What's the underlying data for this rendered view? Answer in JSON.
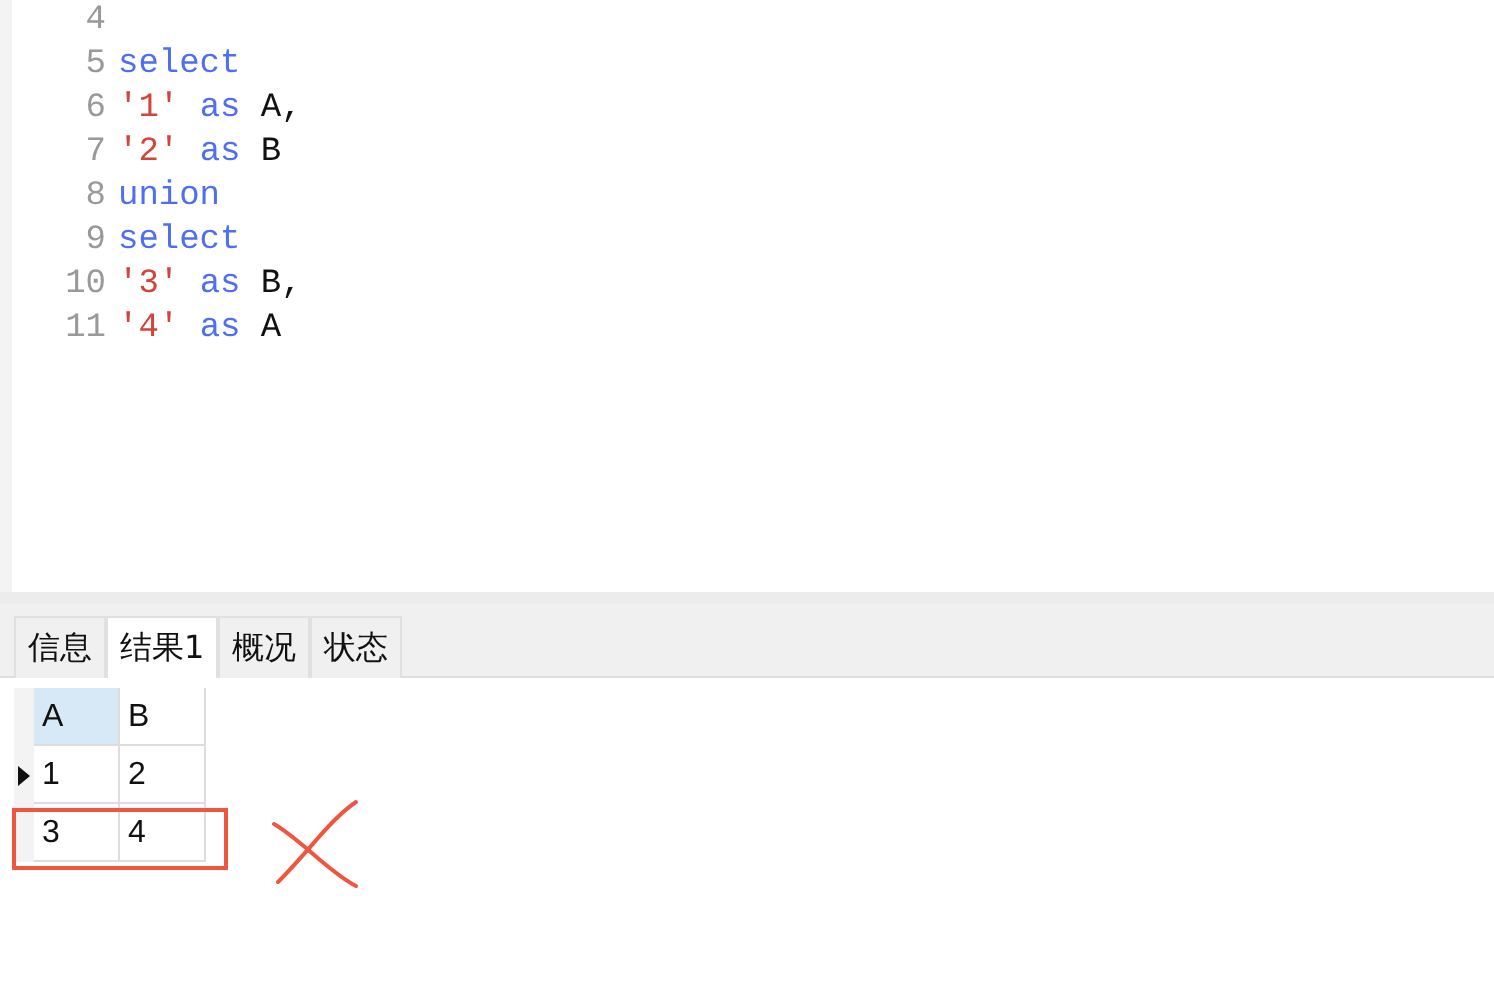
{
  "editor": {
    "lines": [
      {
        "number": "4"
      },
      {
        "number": "5",
        "tokens": [
          {
            "kind": "keyword",
            "text": "select"
          }
        ]
      },
      {
        "number": "6",
        "tokens": [
          {
            "kind": "string",
            "text": "'1'"
          },
          {
            "kind": "keyword",
            "text": "as"
          },
          {
            "kind": "plain",
            "text": "A,"
          }
        ]
      },
      {
        "number": "7",
        "tokens": [
          {
            "kind": "string",
            "text": "'2'"
          },
          {
            "kind": "keyword",
            "text": "as"
          },
          {
            "kind": "plain",
            "text": "B"
          }
        ]
      },
      {
        "number": "8",
        "tokens": [
          {
            "kind": "keyword",
            "text": "union"
          }
        ]
      },
      {
        "number": "9",
        "tokens": [
          {
            "kind": "keyword",
            "text": "select"
          }
        ]
      },
      {
        "number": "10",
        "tokens": [
          {
            "kind": "string",
            "text": "'3'"
          },
          {
            "kind": "keyword",
            "text": "as"
          },
          {
            "kind": "plain",
            "text": "B,"
          }
        ]
      },
      {
        "number": "11",
        "tokens": [
          {
            "kind": "string",
            "text": "'4'"
          },
          {
            "kind": "keyword",
            "text": "as"
          },
          {
            "kind": "plain",
            "text": "A"
          }
        ]
      }
    ]
  },
  "tabs": [
    {
      "label": "信息",
      "selected": false
    },
    {
      "label": "结果1",
      "selected": true
    },
    {
      "label": "概况",
      "selected": false
    },
    {
      "label": "状态",
      "selected": false
    }
  ],
  "grid": {
    "columns": [
      {
        "label": "A",
        "selected": true
      },
      {
        "label": "B",
        "selected": false
      }
    ],
    "rows": [
      {
        "cells": [
          "1",
          "2"
        ],
        "selected": true,
        "marked": false
      },
      {
        "cells": [
          "3",
          "4"
        ],
        "selected": false,
        "marked": true
      }
    ]
  }
}
